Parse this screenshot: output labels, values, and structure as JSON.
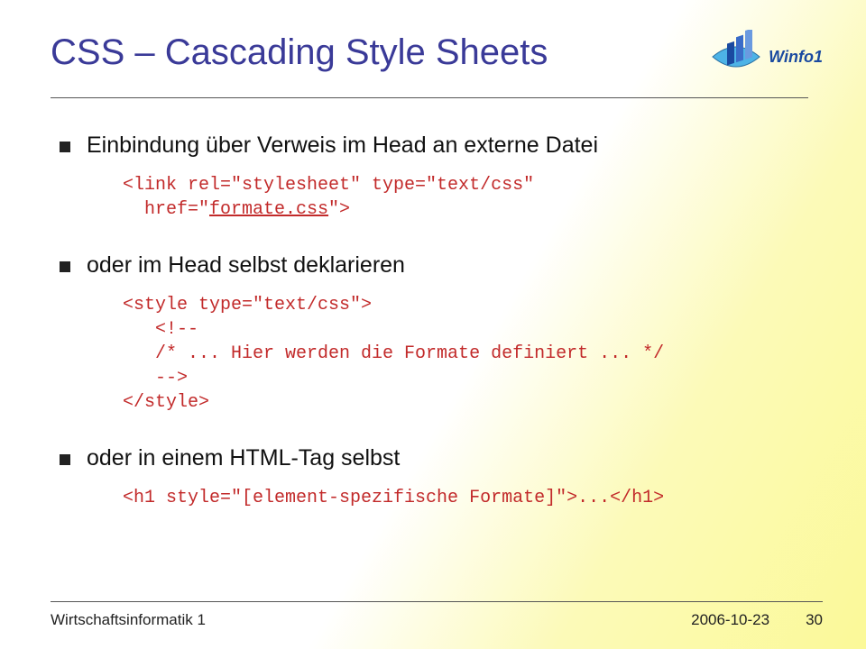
{
  "logo": {
    "text": "Winfo1"
  },
  "title": "CSS – Cascading Style Sheets",
  "bullets": {
    "b1": "Einbindung über Verweis im Head an externe Datei",
    "b2": "oder im Head selbst deklarieren",
    "b3": "oder in einem HTML-Tag selbst"
  },
  "code": {
    "c1a": "<link rel=\"stylesheet\" type=\"text/css\"",
    "c1b": "  href=\"",
    "c1b_u": "formate.css",
    "c1c": "\">",
    "c2_1": "<style type=\"text/css\">",
    "c2_2": "   <!--",
    "c2_3": "   /* ... Hier werden die Formate definiert ... */",
    "c2_4": "   -->",
    "c2_5": "</style>",
    "c3": "<h1 style=\"[element-spezifische Formate]\">...</h1>"
  },
  "footer": {
    "left": "Wirtschaftsinformatik 1",
    "date": "2006-10-23",
    "page": "30"
  }
}
